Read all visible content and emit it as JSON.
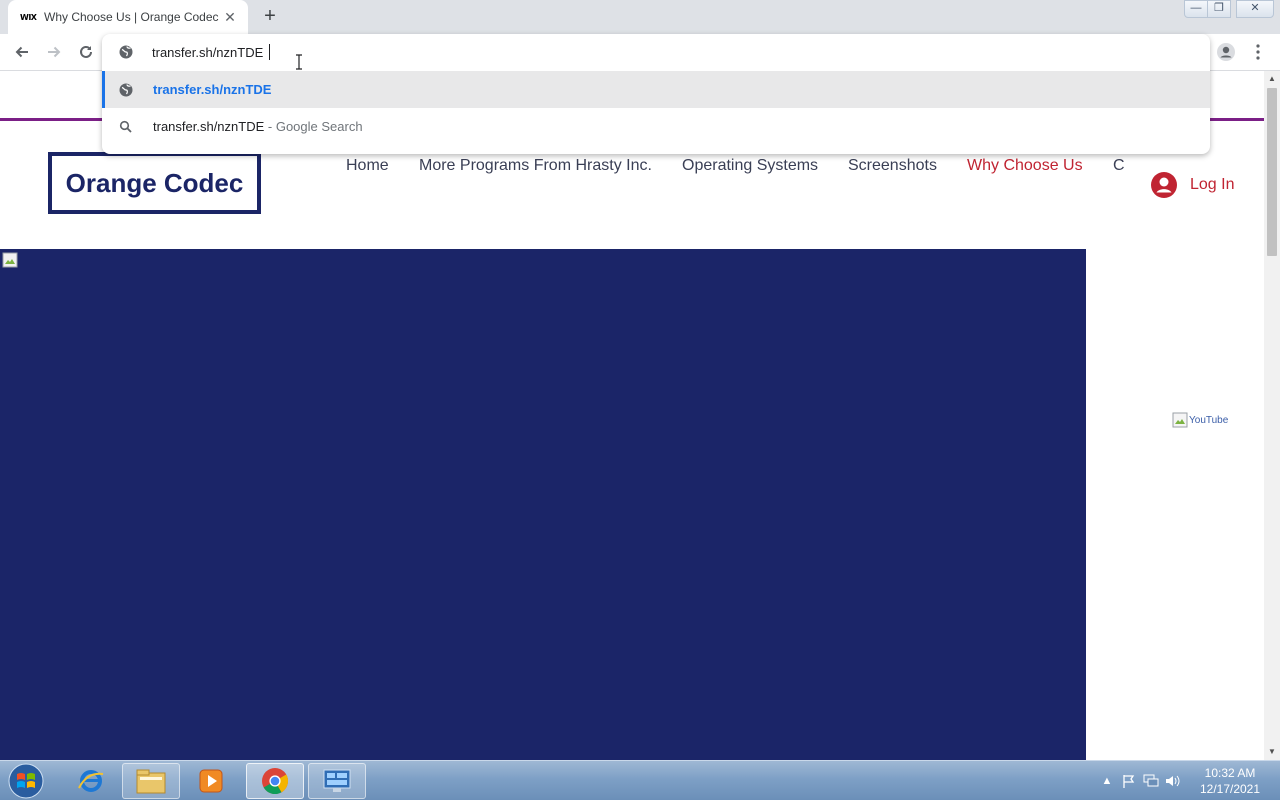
{
  "browser": {
    "tab": {
      "favicon": "WIX",
      "title": "Why Choose Us | Orange Codec",
      "close": "✕"
    },
    "new_tab": "+",
    "window": {
      "minimize": "—",
      "maximize": "❐",
      "close": "✕"
    },
    "omnibox": {
      "value": "transfer.sh/nznTDE",
      "suggestions": [
        {
          "text": "transfer.sh/nznTDE",
          "icon": "globe-icon",
          "kind": "url",
          "selected": true
        },
        {
          "text": "transfer.sh/nznTDE",
          "suffix": " - Google Search",
          "icon": "search-icon",
          "kind": "search",
          "selected": false
        }
      ]
    }
  },
  "site": {
    "logo": "Orange Codec",
    "menu": [
      {
        "label": "Home",
        "active": false
      },
      {
        "label": "More Programs From Hrasty Inc.",
        "active": false
      },
      {
        "label": "Operating Systems",
        "active": false
      },
      {
        "label": "Screenshots",
        "active": false
      },
      {
        "label": "Why Choose Us",
        "active": true
      },
      {
        "label": "C",
        "active": false
      }
    ],
    "login_label": "Log In",
    "youtube_alt": "YouTube",
    "colors": {
      "navy": "#1b2568",
      "accent": "#c02432",
      "divider": "#7b1f86",
      "link": "#1a73e8"
    }
  },
  "taskbar": {
    "apps": [
      "internet-explorer-icon",
      "file-explorer-icon",
      "media-player-icon",
      "chrome-icon",
      "control-panel-icon"
    ],
    "tray": [
      "show-hidden-icons",
      "action-center-flag-icon",
      "network-icon",
      "volume-icon"
    ],
    "time": "10:32 AM",
    "date": "12/17/2021"
  }
}
